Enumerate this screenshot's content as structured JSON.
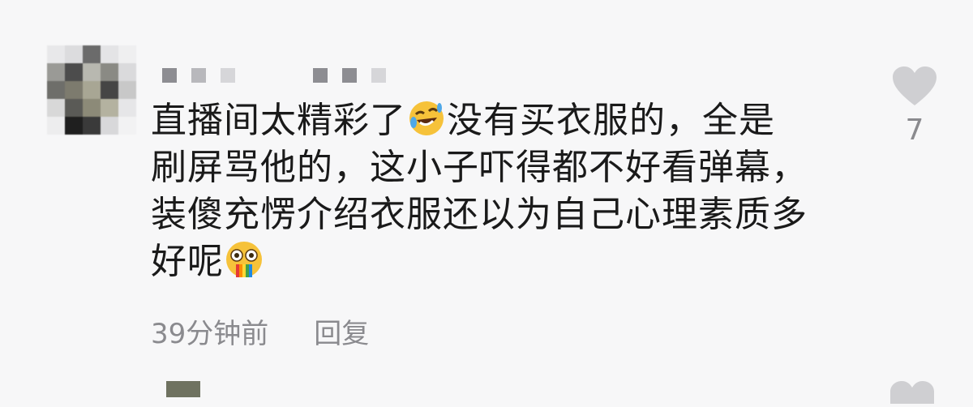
{
  "comment": {
    "avatar_icon": "pixelated-avatar",
    "username_icon": "blurred-username",
    "text_line_1_a": "直播间太精彩了",
    "text_line_1_b": "没有买衣服的，全是",
    "text_line_2": "刷屏骂他的，这小子吓得都不好看弹幕，",
    "text_line_3": "装傻充愣介绍衣服还以为自己心理素质多",
    "text_line_4": "好呢",
    "emoji_1": "rofl-emoji",
    "emoji_2": "vomiting-rainbow-emoji",
    "time": "39分钟前",
    "reply_label": "回复",
    "like_icon": "heart-icon",
    "like_count": "7"
  },
  "colors": {
    "background": "#f7f7f8",
    "text": "#1a1a1a",
    "muted": "#8a8a8e",
    "heart": "#cfcfd2"
  }
}
